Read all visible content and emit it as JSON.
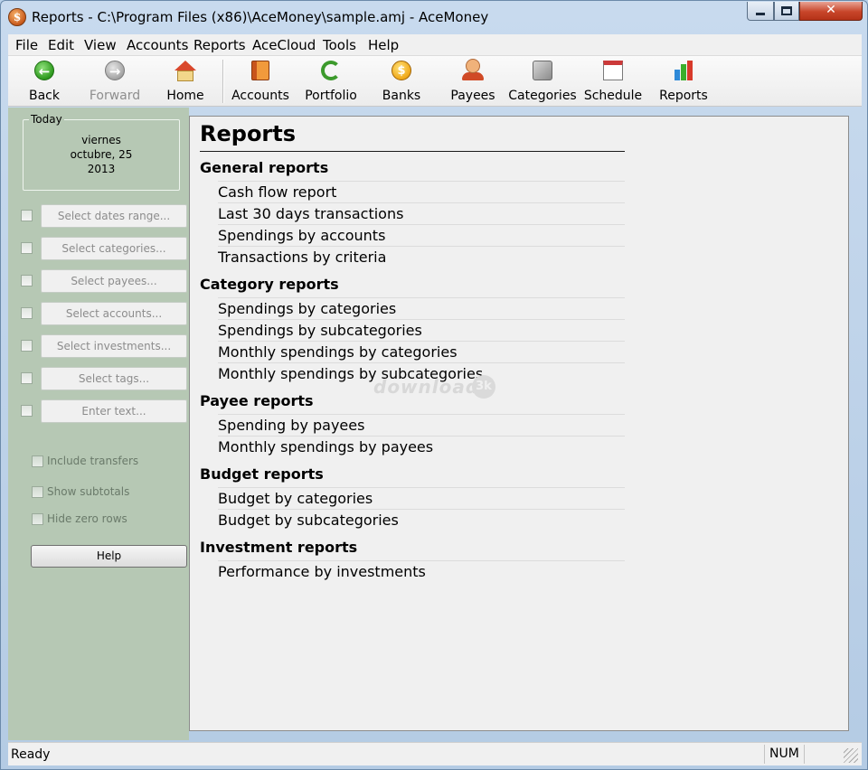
{
  "window": {
    "title": "Reports - C:\\Program Files (x86)\\AceMoney\\sample.amj - AceMoney",
    "app_icon": "acemoney-logo",
    "close_glyph": "✕"
  },
  "menu": [
    {
      "id": "file",
      "label": "File"
    },
    {
      "id": "edit",
      "label": "Edit"
    },
    {
      "id": "view",
      "label": "View"
    },
    {
      "id": "accounts",
      "label": "Accounts"
    },
    {
      "id": "reports",
      "label": "Reports"
    },
    {
      "id": "acecloud",
      "label": "AceCloud"
    },
    {
      "id": "tools",
      "label": "Tools"
    },
    {
      "id": "help",
      "label": "Help"
    }
  ],
  "toolbar": {
    "back": "Back",
    "forward": "Forward",
    "home": "Home",
    "accounts": "Accounts",
    "portfolio": "Portfolio",
    "banks": "Banks",
    "payees": "Payees",
    "categories": "Categories",
    "schedule": "Schedule",
    "reports": "Reports"
  },
  "sidebar": {
    "today_label": "Today",
    "weekday": "viernes",
    "month_day": "octubre, 25",
    "year": "2013",
    "filters": [
      "Select dates range...",
      "Select categories...",
      "Select payees...",
      "Select accounts...",
      "Select investments...",
      "Select tags...",
      "Enter text..."
    ],
    "options": [
      "Include transfers",
      "Show subtotals",
      "Hide zero rows"
    ],
    "help_button": "Help"
  },
  "content": {
    "title": "Reports",
    "sections": [
      {
        "heading": "General reports",
        "items": [
          "Cash flow report",
          "Last 30 days transactions",
          "Spendings by accounts",
          "Transactions by criteria"
        ]
      },
      {
        "heading": "Category reports",
        "items": [
          "Spendings by categories",
          "Spendings by subcategories",
          "Monthly spendings by categories",
          "Monthly spendings by subcategories"
        ]
      },
      {
        "heading": "Payee reports",
        "items": [
          "Spending by payees",
          "Monthly spendings by payees"
        ]
      },
      {
        "heading": "Budget reports",
        "items": [
          "Budget by categories",
          "Budget by subcategories"
        ]
      },
      {
        "heading": "Investment reports",
        "items": [
          "Performance by investments"
        ]
      }
    ],
    "watermark": "download",
    "watermark_badge": "3k"
  },
  "status": {
    "text": "Ready",
    "num": "NUM"
  },
  "colors": {
    "sidebar_bg": "#b6c8b4",
    "content_bg": "#f0f0f0",
    "close_button": "#c8452a"
  }
}
